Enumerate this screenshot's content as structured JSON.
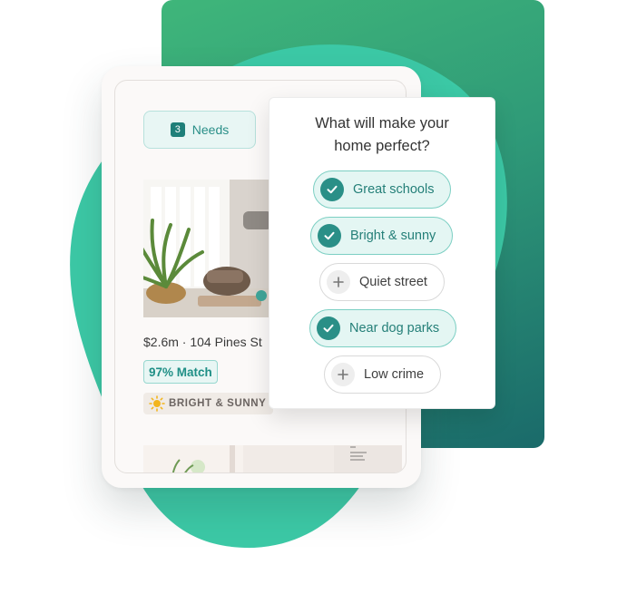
{
  "needs": {
    "count": "3",
    "label": "Needs"
  },
  "listing": {
    "price_address": "$2.6m · 104 Pines St",
    "match": "97% Match",
    "feature_badge": "BRIGHT & SUNNY",
    "feature_icon": "sun-icon"
  },
  "popover": {
    "title_line1": "What will make your",
    "title_line2": "home perfect?",
    "options": [
      {
        "label": "Great schools",
        "selected": true,
        "icon": "check-icon"
      },
      {
        "label": "Bright & sunny",
        "selected": true,
        "icon": "check-icon"
      },
      {
        "label": "Quiet street",
        "selected": false,
        "icon": "plus-icon"
      },
      {
        "label": "Near dog parks",
        "selected": true,
        "icon": "check-icon"
      },
      {
        "label": "Low crime",
        "selected": false,
        "icon": "plus-icon"
      }
    ]
  },
  "colors": {
    "accent": "#2a8f87",
    "blob": "#3cc9a6",
    "panel_gradient_top": "#3fb67a",
    "panel_gradient_bottom": "#1a6a6a"
  }
}
